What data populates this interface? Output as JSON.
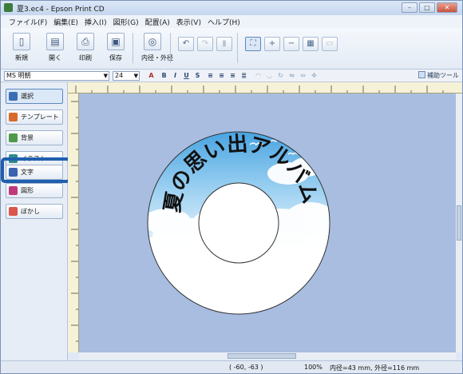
{
  "window": {
    "title": "夏3.ec4 - Epson Print CD"
  },
  "menu": [
    "ファイル(F)",
    "編集(E)",
    "挿入(I)",
    "図形(G)",
    "配置(A)",
    "表示(V)",
    "ヘルプ(H)"
  ],
  "toolbar": {
    "new": "新規",
    "open": "開く",
    "print": "印刷",
    "save": "保存",
    "diameter": "内径・外径"
  },
  "fontbar": {
    "font": "MS 明朝",
    "size": "24",
    "assist": "補助ツール"
  },
  "sidebar": {
    "items": [
      "選択",
      "テンプレート",
      "背景",
      "イラスト",
      "文字",
      "図形",
      "ぼかし"
    ]
  },
  "design": {
    "text": "夏の思い出アルバム"
  },
  "status": {
    "coords": "( -60, -63 )",
    "zoom": "100%",
    "dims": "内径=43 mm, 外径=116 mm"
  },
  "colors": {
    "canvas": "#a8bde0",
    "highlight": "#1f5fae",
    "sky_top": "#3f9fe0"
  }
}
